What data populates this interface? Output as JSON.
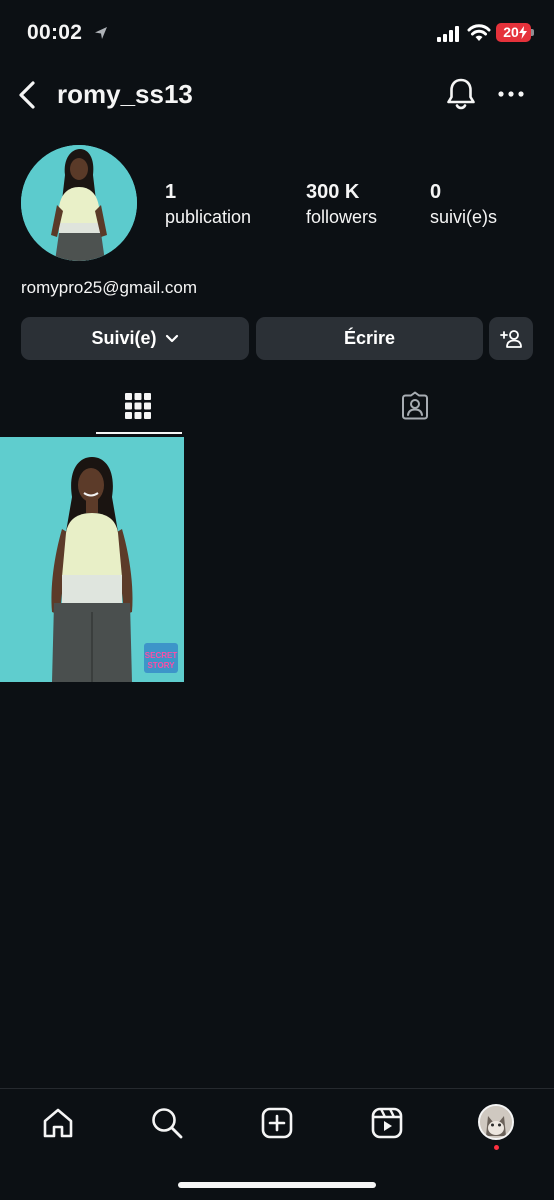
{
  "status_bar": {
    "time": "00:02",
    "battery": "20"
  },
  "header": {
    "username": "romy_ss13"
  },
  "profile": {
    "stats": [
      {
        "value": "1",
        "label": "publication"
      },
      {
        "value": "300 K",
        "label": "followers"
      },
      {
        "value": "0",
        "label": "suivi(e)s"
      }
    ],
    "bio": "romypro25@gmail.com"
  },
  "actions": {
    "follow_label": "Suivi(e)",
    "message_label": "Écrire"
  },
  "post": {
    "badge_line1": "SECRET",
    "badge_line2": "STORY"
  },
  "colors": {
    "background": "#0c1014",
    "button": "#2b3036",
    "battery": "#e5323b",
    "accent_dot": "#ff3040"
  }
}
